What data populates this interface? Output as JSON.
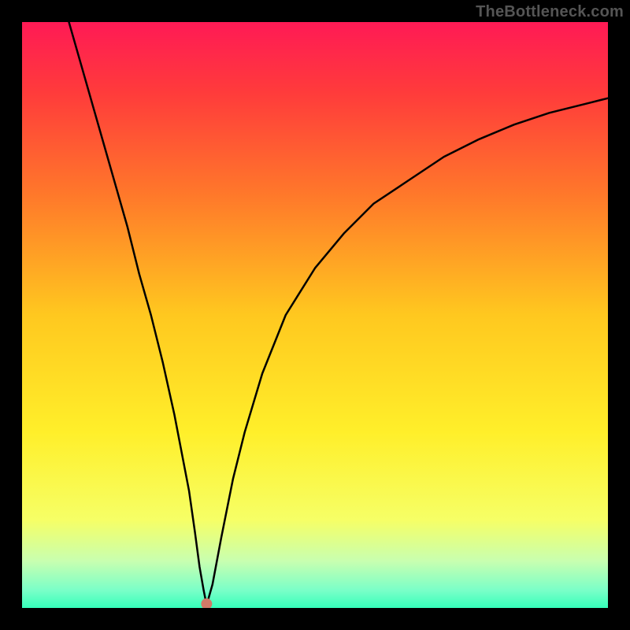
{
  "watermark": "TheBottleneck.com",
  "chart_data": {
    "type": "line",
    "title": "",
    "xlabel": "",
    "ylabel": "",
    "xlim": [
      0,
      100
    ],
    "ylim": [
      0,
      100
    ],
    "grid": false,
    "legend": false,
    "background": {
      "type": "vertical-gradient",
      "stops": [
        {
          "pos": 0.0,
          "color": "#ff1a55"
        },
        {
          "pos": 0.12,
          "color": "#ff3b3b"
        },
        {
          "pos": 0.3,
          "color": "#ff7a2a"
        },
        {
          "pos": 0.5,
          "color": "#ffc81f"
        },
        {
          "pos": 0.7,
          "color": "#ffef2a"
        },
        {
          "pos": 0.85,
          "color": "#f6ff66"
        },
        {
          "pos": 0.92,
          "color": "#c8ffb0"
        },
        {
          "pos": 0.97,
          "color": "#7affc8"
        },
        {
          "pos": 1.0,
          "color": "#35ffba"
        }
      ]
    },
    "series": [
      {
        "name": "curve-left",
        "x": [
          8,
          10,
          12,
          14,
          16,
          18,
          20,
          22,
          24,
          26,
          28.5,
          29.5,
          30.3,
          31,
          31.5
        ],
        "y": [
          100,
          93,
          86,
          79,
          72,
          65,
          57,
          50,
          42,
          33,
          20,
          13,
          7,
          3,
          0.5
        ],
        "color": "#000000"
      },
      {
        "name": "curve-right",
        "x": [
          31.5,
          32.5,
          34,
          36,
          38,
          41,
          45,
          50,
          55,
          60,
          66,
          72,
          78,
          84,
          90,
          96,
          100
        ],
        "y": [
          0.5,
          4,
          12,
          22,
          30,
          40,
          50,
          58,
          64,
          69,
          73,
          77,
          80,
          82.5,
          84.5,
          86,
          87
        ],
        "color": "#000000"
      }
    ],
    "marker": {
      "name": "bottleneck-point",
      "x": 31.5,
      "y": 0.7,
      "color": "#d07a68",
      "radius_px": 7
    }
  }
}
